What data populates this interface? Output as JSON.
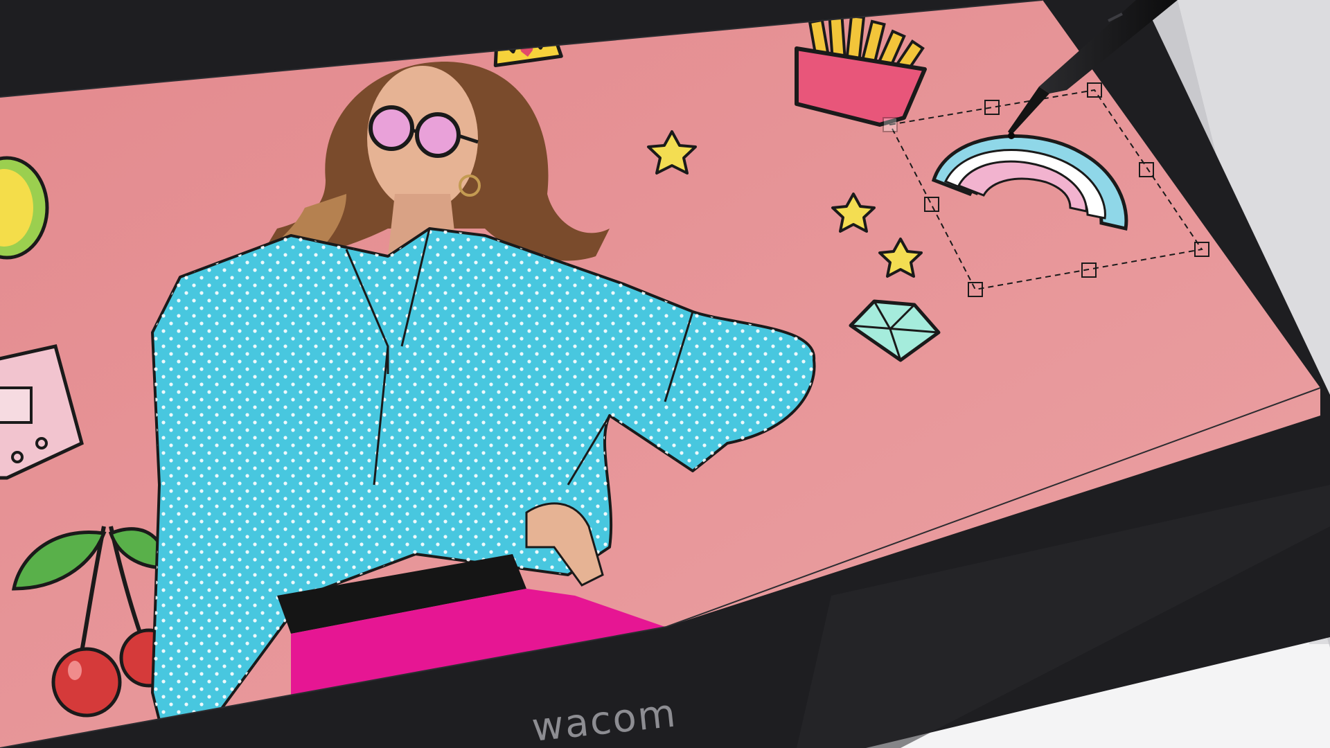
{
  "device": {
    "brand_logo_text": "wacom",
    "bezel_color": "#1e1e21",
    "chassis_color": "#d9d9dc",
    "screen_background_color": "#e58f93"
  },
  "canvas_artwork": {
    "subject": {
      "shirt_color": "#48c7df",
      "pants_color": "#e61693",
      "belt_color": "#151515",
      "hair_color": "#7a4b2c",
      "skin_color": "#e6b394",
      "sunglasses_lens_color": "#e9a1d9"
    },
    "stickers": [
      {
        "icon": "crown-icon",
        "color": "#f6d23b"
      },
      {
        "icon": "french-fries-icon",
        "color": "#f2c53a"
      },
      {
        "icon": "star-icon",
        "color": "#f3dd52"
      },
      {
        "icon": "rainbow-icon",
        "color": "#8fd7e8"
      },
      {
        "icon": "diamond-icon",
        "color": "#a5ecdc"
      },
      {
        "icon": "cherry-icon",
        "color": "#d53a3a"
      },
      {
        "icon": "cassette-icon",
        "color": "#f2c4cf"
      },
      {
        "icon": "lemon-icon",
        "color": "#f4dd4a"
      }
    ],
    "selection_box": {
      "style": "dashed",
      "handle_count": 8
    }
  },
  "stylus": {
    "icon": "stylus-pen-icon",
    "color": "#1a1a1c"
  }
}
